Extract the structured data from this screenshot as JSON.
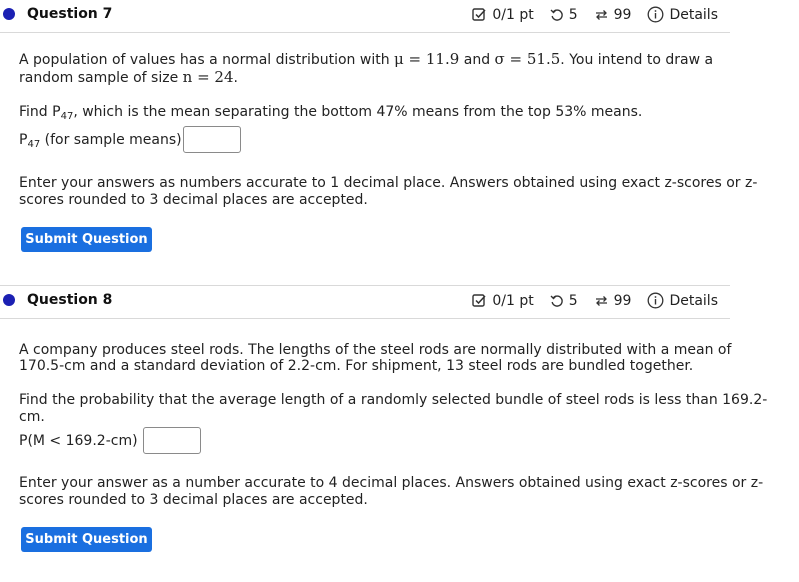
{
  "questions": [
    {
      "title": "Question 7",
      "score": "0/1 pt",
      "retries": "5",
      "attempts": "99",
      "details": "Details",
      "intro_a": "A population of values has a normal distribution with ",
      "mu": "μ = 11.9",
      "intro_and": " and ",
      "sigma": "σ = 51.5",
      "intro_b": ". You intend to draw a",
      "intro_c": "random sample of size ",
      "n": "n = 24",
      "intro_end": ".",
      "find_a": "Find P",
      "find_sub": "47",
      "find_b": ", which is the mean separating the bottom 47% means from the top 53% means.",
      "answer_label_a": "P",
      "answer_label_sub": "47",
      "answer_label_b": " (for sample means) =",
      "note_line1": "Enter your answers as numbers accurate to 1 decimal place. Answers obtained using exact z-scores or z-",
      "note_line2": "scores rounded to 3 decimal places are accepted.",
      "submit": "Submit Question"
    },
    {
      "title": "Question 8",
      "score": "0/1 pt",
      "retries": "5",
      "attempts": "99",
      "details": "Details",
      "intro_line1": "A company produces steel rods. The lengths of the steel rods are normally distributed with a mean of",
      "intro_line2": "170.5-cm and a standard deviation of 2.2-cm. For shipment, 13 steel rods are bundled together.",
      "find_line1": "Find the probability that the average length of a randomly selected bundle of steel rods is less than 169.2-",
      "find_line2": "cm.",
      "answer_label": "P(M < 169.2-cm) =",
      "note_line1": "Enter your answer as a number accurate to 4 decimal places. Answers obtained using exact z-scores or z-",
      "note_line2": "scores rounded to 3 decimal places are accepted.",
      "submit": "Submit Question"
    }
  ],
  "colors": {
    "accent": "#1a6fe0",
    "dot": "#1b20b3"
  }
}
